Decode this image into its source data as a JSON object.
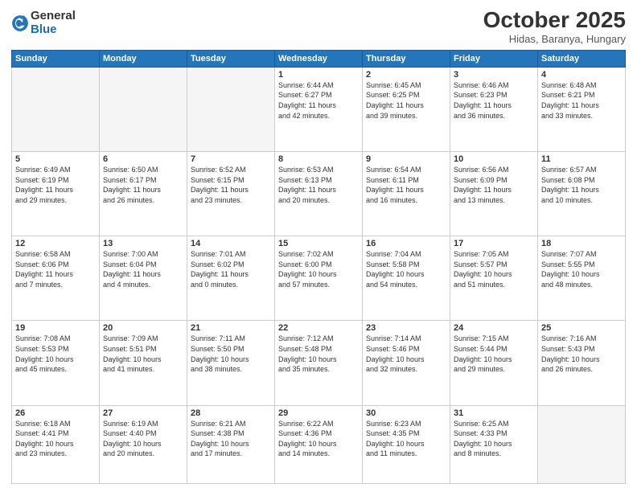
{
  "logo": {
    "general": "General",
    "blue": "Blue"
  },
  "header": {
    "title": "October 2025",
    "subtitle": "Hidas, Baranya, Hungary"
  },
  "weekdays": [
    "Sunday",
    "Monday",
    "Tuesday",
    "Wednesday",
    "Thursday",
    "Friday",
    "Saturday"
  ],
  "weeks": [
    [
      {
        "day": "",
        "info": ""
      },
      {
        "day": "",
        "info": ""
      },
      {
        "day": "",
        "info": ""
      },
      {
        "day": "1",
        "info": "Sunrise: 6:44 AM\nSunset: 6:27 PM\nDaylight: 11 hours\nand 42 minutes."
      },
      {
        "day": "2",
        "info": "Sunrise: 6:45 AM\nSunset: 6:25 PM\nDaylight: 11 hours\nand 39 minutes."
      },
      {
        "day": "3",
        "info": "Sunrise: 6:46 AM\nSunset: 6:23 PM\nDaylight: 11 hours\nand 36 minutes."
      },
      {
        "day": "4",
        "info": "Sunrise: 6:48 AM\nSunset: 6:21 PM\nDaylight: 11 hours\nand 33 minutes."
      }
    ],
    [
      {
        "day": "5",
        "info": "Sunrise: 6:49 AM\nSunset: 6:19 PM\nDaylight: 11 hours\nand 29 minutes."
      },
      {
        "day": "6",
        "info": "Sunrise: 6:50 AM\nSunset: 6:17 PM\nDaylight: 11 hours\nand 26 minutes."
      },
      {
        "day": "7",
        "info": "Sunrise: 6:52 AM\nSunset: 6:15 PM\nDaylight: 11 hours\nand 23 minutes."
      },
      {
        "day": "8",
        "info": "Sunrise: 6:53 AM\nSunset: 6:13 PM\nDaylight: 11 hours\nand 20 minutes."
      },
      {
        "day": "9",
        "info": "Sunrise: 6:54 AM\nSunset: 6:11 PM\nDaylight: 11 hours\nand 16 minutes."
      },
      {
        "day": "10",
        "info": "Sunrise: 6:56 AM\nSunset: 6:09 PM\nDaylight: 11 hours\nand 13 minutes."
      },
      {
        "day": "11",
        "info": "Sunrise: 6:57 AM\nSunset: 6:08 PM\nDaylight: 11 hours\nand 10 minutes."
      }
    ],
    [
      {
        "day": "12",
        "info": "Sunrise: 6:58 AM\nSunset: 6:06 PM\nDaylight: 11 hours\nand 7 minutes."
      },
      {
        "day": "13",
        "info": "Sunrise: 7:00 AM\nSunset: 6:04 PM\nDaylight: 11 hours\nand 4 minutes."
      },
      {
        "day": "14",
        "info": "Sunrise: 7:01 AM\nSunset: 6:02 PM\nDaylight: 11 hours\nand 0 minutes."
      },
      {
        "day": "15",
        "info": "Sunrise: 7:02 AM\nSunset: 6:00 PM\nDaylight: 10 hours\nand 57 minutes."
      },
      {
        "day": "16",
        "info": "Sunrise: 7:04 AM\nSunset: 5:58 PM\nDaylight: 10 hours\nand 54 minutes."
      },
      {
        "day": "17",
        "info": "Sunrise: 7:05 AM\nSunset: 5:57 PM\nDaylight: 10 hours\nand 51 minutes."
      },
      {
        "day": "18",
        "info": "Sunrise: 7:07 AM\nSunset: 5:55 PM\nDaylight: 10 hours\nand 48 minutes."
      }
    ],
    [
      {
        "day": "19",
        "info": "Sunrise: 7:08 AM\nSunset: 5:53 PM\nDaylight: 10 hours\nand 45 minutes."
      },
      {
        "day": "20",
        "info": "Sunrise: 7:09 AM\nSunset: 5:51 PM\nDaylight: 10 hours\nand 41 minutes."
      },
      {
        "day": "21",
        "info": "Sunrise: 7:11 AM\nSunset: 5:50 PM\nDaylight: 10 hours\nand 38 minutes."
      },
      {
        "day": "22",
        "info": "Sunrise: 7:12 AM\nSunset: 5:48 PM\nDaylight: 10 hours\nand 35 minutes."
      },
      {
        "day": "23",
        "info": "Sunrise: 7:14 AM\nSunset: 5:46 PM\nDaylight: 10 hours\nand 32 minutes."
      },
      {
        "day": "24",
        "info": "Sunrise: 7:15 AM\nSunset: 5:44 PM\nDaylight: 10 hours\nand 29 minutes."
      },
      {
        "day": "25",
        "info": "Sunrise: 7:16 AM\nSunset: 5:43 PM\nDaylight: 10 hours\nand 26 minutes."
      }
    ],
    [
      {
        "day": "26",
        "info": "Sunrise: 6:18 AM\nSunset: 4:41 PM\nDaylight: 10 hours\nand 23 minutes."
      },
      {
        "day": "27",
        "info": "Sunrise: 6:19 AM\nSunset: 4:40 PM\nDaylight: 10 hours\nand 20 minutes."
      },
      {
        "day": "28",
        "info": "Sunrise: 6:21 AM\nSunset: 4:38 PM\nDaylight: 10 hours\nand 17 minutes."
      },
      {
        "day": "29",
        "info": "Sunrise: 6:22 AM\nSunset: 4:36 PM\nDaylight: 10 hours\nand 14 minutes."
      },
      {
        "day": "30",
        "info": "Sunrise: 6:23 AM\nSunset: 4:35 PM\nDaylight: 10 hours\nand 11 minutes."
      },
      {
        "day": "31",
        "info": "Sunrise: 6:25 AM\nSunset: 4:33 PM\nDaylight: 10 hours\nand 8 minutes."
      },
      {
        "day": "",
        "info": ""
      }
    ]
  ]
}
